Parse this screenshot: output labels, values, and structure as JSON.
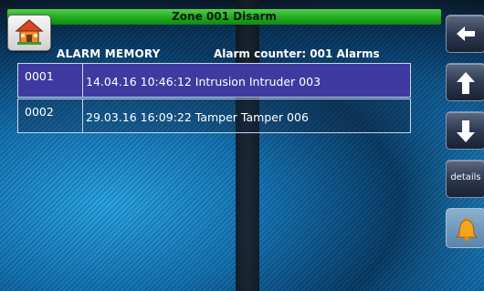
{
  "header": {
    "title": "Zone 001  Disarm"
  },
  "page": {
    "section_title": "ALARM MEMORY",
    "counter_text": "Alarm counter:  001  Alarms"
  },
  "alarms": [
    {
      "id": "0001",
      "text": "14.04.16 10:46:12  Intrusion  Intruder 003",
      "selected": true
    },
    {
      "id": "0002",
      "text": "29.03.16 16:09:22  Tamper  Tamper 006",
      "selected": false
    }
  ],
  "sidebar": {
    "back_icon": "arrow-left-icon",
    "up_icon": "arrow-up-icon",
    "down_icon": "arrow-down-icon",
    "details_label": "details",
    "bell_icon": "bell-icon"
  },
  "colors": {
    "title_bar": "#21a821",
    "selected_row": "#3f3aa0",
    "bell_button": "#5a84ad"
  }
}
